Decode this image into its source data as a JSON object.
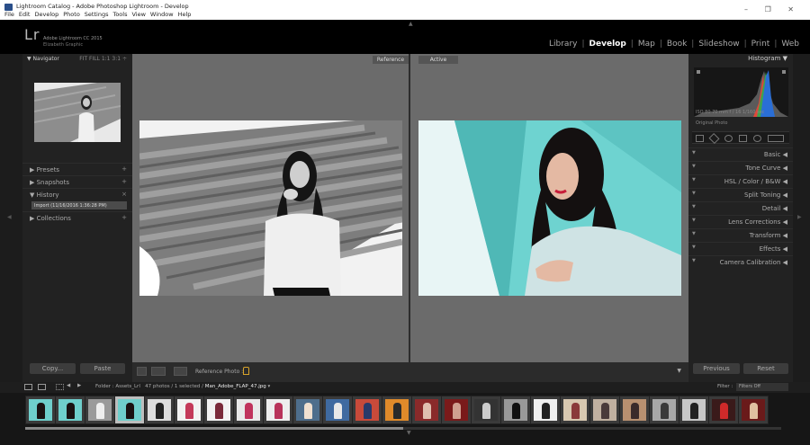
{
  "window": {
    "title": "Lightroom Catalog - Adobe Photoshop Lightroom - Develop",
    "menu": [
      "File",
      "Edit",
      "Develop",
      "Photo",
      "Settings",
      "Tools",
      "View",
      "Window",
      "Help"
    ],
    "controls": "–  ❐  ✕"
  },
  "identity": {
    "logo": "Lr",
    "product": "Adobe Lightroom CC 2015",
    "user": "Elizabeth Graphic"
  },
  "modules": [
    {
      "label": "Library",
      "active": false
    },
    {
      "label": "Develop",
      "active": true
    },
    {
      "label": "Map",
      "active": false
    },
    {
      "label": "Book",
      "active": false
    },
    {
      "label": "Slideshow",
      "active": false
    },
    {
      "label": "Print",
      "active": false
    },
    {
      "label": "Web",
      "active": false
    }
  ],
  "left_panel": {
    "navigator": {
      "label": "Navigator",
      "zoom_options": "FIT  FILL  1:1  3:1 ÷"
    },
    "sections": {
      "presets": "Presets",
      "snapshots": "Snapshots",
      "history": "History",
      "collections": "Collections"
    },
    "history_item": "Import (11/16/2016 1:36:28 PM)",
    "copy_label": "Copy...",
    "paste_label": "Paste"
  },
  "center": {
    "reference_label": "Reference",
    "active_label": "Active"
  },
  "toolbar": {
    "reference_photo_label": "Reference Photo :"
  },
  "right_panel": {
    "histogram_label": "Histogram",
    "hist_info": "ISO 80     70 mm     f / 16     1/160 sec",
    "original_photo": "Original Photo",
    "panels": [
      "Basic",
      "Tone Curve",
      "HSL / Color / B&W",
      "Split Toning",
      "Detail",
      "Lens Corrections",
      "Transform",
      "Effects",
      "Camera Calibration"
    ],
    "previous_label": "Previous",
    "reset_label": "Reset"
  },
  "filmstrip": {
    "folder": "Folder : Assets_Lrl",
    "count": "47 photos / 1 selected /",
    "filename": "Man_Adobe_FLAP_47.jpg",
    "filter_label": "Filter :",
    "filter_value": "Filters Off"
  },
  "colors": {
    "accent": "#ffffff",
    "teal_bg": "#6fcfcc",
    "lock": "#d8a32a"
  }
}
